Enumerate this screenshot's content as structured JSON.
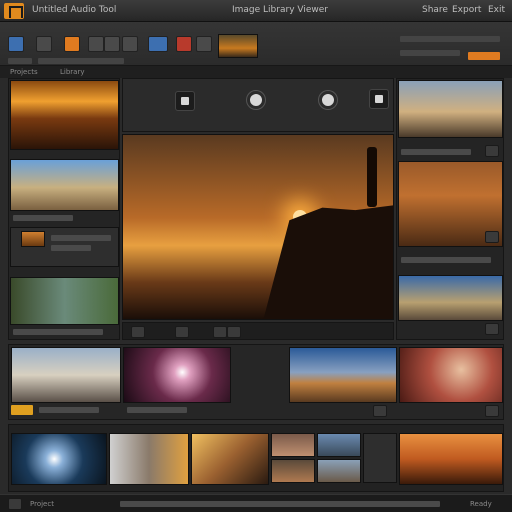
{
  "app": {
    "title_left": "Untitled Audio Tool",
    "title_center": "Image Library Viewer",
    "title_right_1": "Share",
    "title_right_2": "Export",
    "title_right_3": "Exit"
  },
  "toolbar": {
    "project_label": "Projects",
    "panel_label": "Library"
  },
  "colors": {
    "accent": "#e07b20",
    "background": "#2a2a2a",
    "panel": "#242424"
  },
  "status": {
    "left_label": "Project",
    "right_label": "Ready"
  }
}
